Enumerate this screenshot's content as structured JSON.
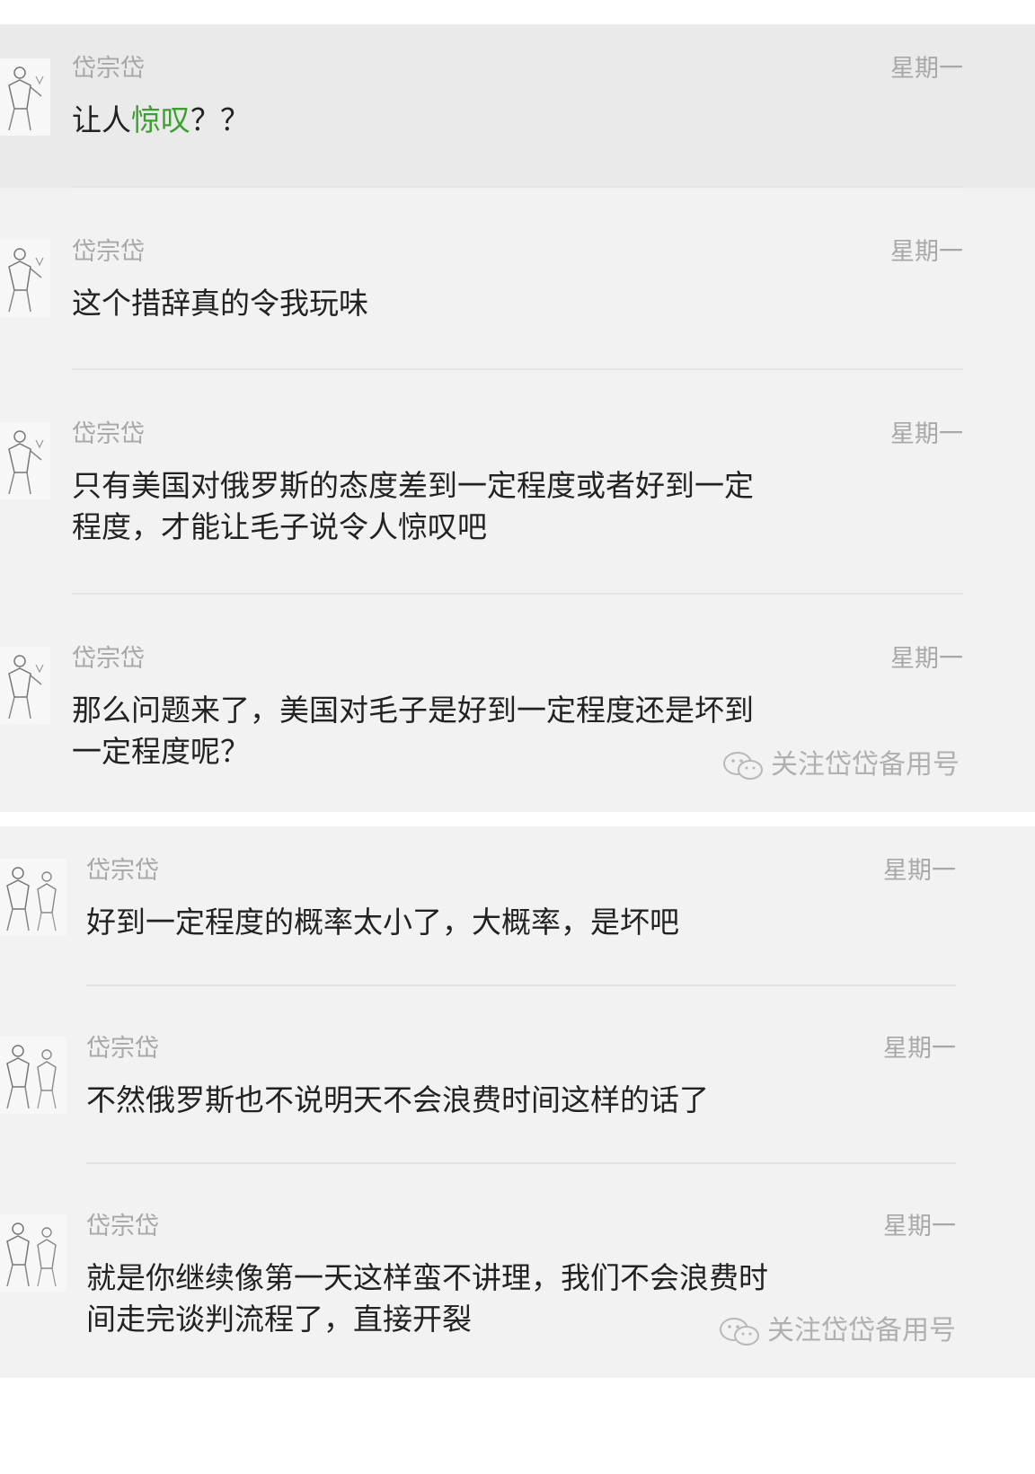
{
  "panels": [
    {
      "messages": [
        {
          "name": "岱宗岱",
          "date": "星期一",
          "pre": "让人",
          "hl": "惊叹",
          "post": "？？"
        },
        {
          "name": "岱宗岱",
          "date": "星期一",
          "line1": "这个措辞真的令我玩味"
        },
        {
          "name": "岱宗岱",
          "date": "星期一",
          "line1": "只有美国对俄罗斯的态度差到一定程度或者好到一定",
          "line2": "程度，才能让毛子说令人惊叹吧"
        },
        {
          "name": "岱宗岱",
          "date": "星期一",
          "line1": "那么问题来了，美国对毛子是好到一定程度还是坏到",
          "line2": "一定程度呢？"
        }
      ],
      "watermark": "关注岱岱备用号"
    },
    {
      "messages": [
        {
          "name": "岱宗岱",
          "date": "星期一",
          "line1": "好到一定程度的概率太小了，大概率，是坏吧"
        },
        {
          "name": "岱宗岱",
          "date": "星期一",
          "line1": "不然俄罗斯也不说明天不会浪费时间这样的话了"
        },
        {
          "name": "岱宗岱",
          "date": "星期一",
          "line1": "就是你继续像第一天这样蛮不讲理，我们不会浪费时",
          "line2": "间走完谈判流程了，直接开裂"
        }
      ],
      "watermark": "关注岱岱备用号"
    }
  ],
  "icons": {
    "avatar": "avatar-sketch-icon",
    "watermark": "wechat-icon"
  },
  "colors": {
    "highlight": "#3c9f2f",
    "panel_bg": "#f2f2f2",
    "active_row_bg": "#eaeaea",
    "meta_text": "#a8a8a8"
  }
}
